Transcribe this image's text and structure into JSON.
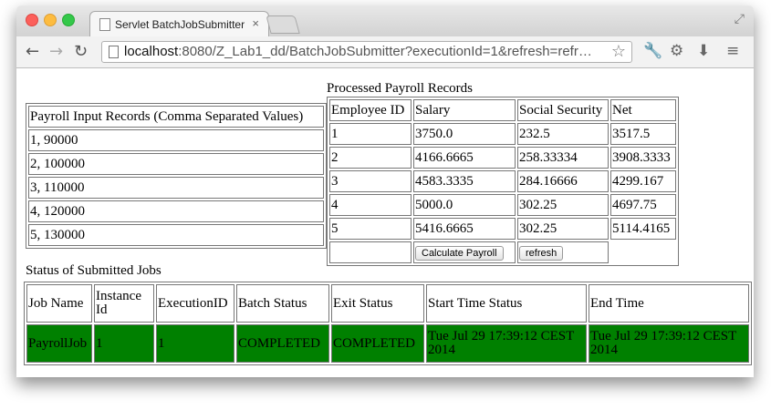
{
  "browser": {
    "tab_title": "Servlet BatchJobSubmitter",
    "tab_close": "×",
    "url_host": "localhost",
    "url_rest": ":8080/Z_Lab1_dd/BatchJobSubmitter?executionId=1&refresh=refr…"
  },
  "input": {
    "header": "Payroll Input Records (Comma Separated Values)",
    "rows": [
      "1, 90000",
      "2, 100000",
      "3, 110000",
      "4, 120000",
      "5, 130000"
    ]
  },
  "payroll": {
    "title": "Processed Payroll Records",
    "headers": [
      "Employee ID",
      "Salary",
      "Social Security",
      "Net"
    ],
    "rows": [
      [
        "1",
        "3750.0",
        "232.5",
        "3517.5"
      ],
      [
        "2",
        "4166.6665",
        "258.33334",
        "3908.3333"
      ],
      [
        "3",
        "4583.3335",
        "284.16666",
        "4299.167"
      ],
      [
        "4",
        "5000.0",
        "302.25",
        "4697.75"
      ],
      [
        "5",
        "5416.6665",
        "302.25",
        "5114.4165"
      ]
    ],
    "calc_button": "Calculate Payroll",
    "refresh_button": "refresh"
  },
  "jobs": {
    "title": "Status of Submitted Jobs",
    "headers": [
      "Job Name",
      "Instance Id",
      "ExecutionID",
      "Batch Status",
      "Exit Status",
      "Start Time Status",
      "End Time"
    ],
    "row": [
      "PayrollJob",
      "1",
      "1",
      "COMPLETED",
      "COMPLETED",
      "Tue Jul 29 17:39:12 CEST 2014",
      "Tue Jul 29 17:39:12 CEST 2014"
    ],
    "row_color": "#008000"
  }
}
